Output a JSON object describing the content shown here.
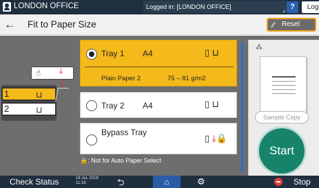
{
  "header": {
    "office": "LONDON OFFICE",
    "logged_in": "Logged in: [LONDON OFFICE]",
    "help": "?",
    "logout": "Logout",
    "cut": "(",
    "login_mark": "⌟"
  },
  "titlebar": {
    "back": "←",
    "title": "Fit to Paper Size",
    "reset": "Reset"
  },
  "illustration": {
    "drawer1": "1",
    "drawer2": "2"
  },
  "trays": [
    {
      "label": "Tray 1",
      "size": "A4",
      "paper_type": "Plain Paper 2",
      "weight": "75 – 81 g/m2",
      "selected": true
    },
    {
      "label": "Tray 2",
      "size": "A4",
      "selected": false
    },
    {
      "label": "Bypass Tray",
      "size": "",
      "selected": false
    }
  ],
  "note": "🔒: Not for Auto Paper Select",
  "right_panel": {
    "sample_copy": "Sample Copy",
    "start": "Start"
  },
  "bottombar": {
    "check_status": "Check Status",
    "date_line1": "18 Jul, 2018",
    "date_line2": "11:18",
    "stop": "Stop"
  },
  "colors": {
    "selected_tray": "#f4b91a",
    "start_button": "#17836b",
    "header_bg": "#1f2f3f",
    "reset_border": "#f0a018"
  }
}
